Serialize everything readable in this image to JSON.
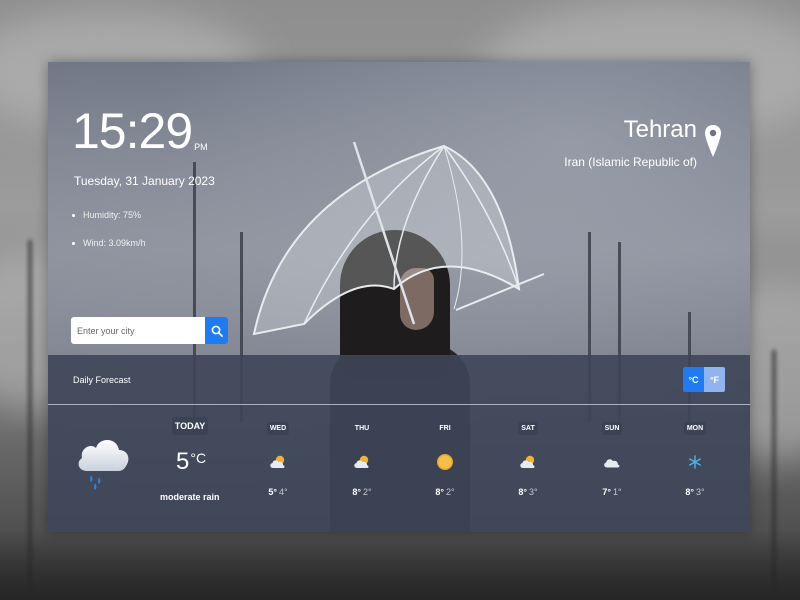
{
  "clock": {
    "time": "15:29",
    "ampm": "PM",
    "date": "Tuesday, 31 January 2023"
  },
  "stats": {
    "humidity": "Humidity: 75%",
    "wind": "Wind: 3.09km/h"
  },
  "search": {
    "placeholder": "Enter your city",
    "icon": "search-icon"
  },
  "location": {
    "city": "Tehran",
    "country": "Iran (Islamic Republic of)",
    "icon": "location-pin-icon"
  },
  "forecast": {
    "title": "Daily Forecast",
    "units": {
      "celsius": "°C",
      "fahrenheit": "°F"
    },
    "today": {
      "label": "TODAY",
      "temp": "5",
      "deg": "°C",
      "description": "moderate rain",
      "icon": "cloud-rain-icon"
    },
    "days": [
      {
        "name": "WED",
        "high": "5°",
        "low": "4°",
        "icon": "partly-cloudy-icon"
      },
      {
        "name": "THU",
        "high": "8°",
        "low": "2°",
        "icon": "partly-cloudy-icon"
      },
      {
        "name": "FRI",
        "high": "8°",
        "low": "2°",
        "icon": "sun-icon"
      },
      {
        "name": "SAT",
        "high": "8°",
        "low": "3°",
        "icon": "partly-cloudy-icon"
      },
      {
        "name": "SUN",
        "high": "7°",
        "low": "1°",
        "icon": "cloud-icon"
      },
      {
        "name": "MON",
        "high": "8°",
        "low": "3°",
        "icon": "snowflake-icon"
      }
    ]
  },
  "colors": {
    "accent": "#1e7bf2",
    "panel": "#3e4658"
  }
}
